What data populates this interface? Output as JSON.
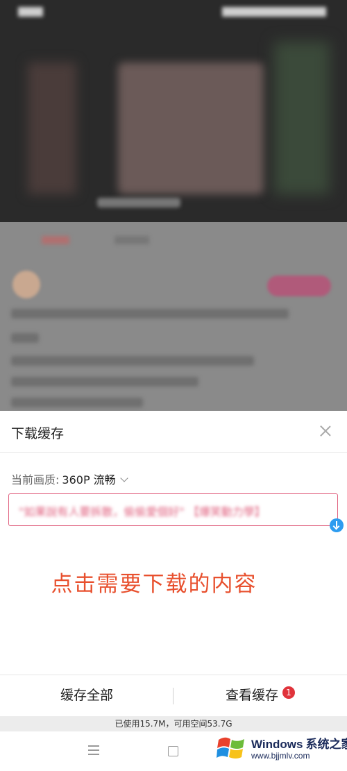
{
  "sheet": {
    "title": "下载缓存",
    "quality_label": "当前画质:",
    "quality_value": "360P 流畅",
    "episode_title": "\"如果說有人要拆散，偷偷愛個好\" 【爆笑動力學】"
  },
  "instruction": "点击需要下载的内容",
  "actions": {
    "cache_all": "缓存全部",
    "view_cache": "查看缓存",
    "view_cache_badge": "1"
  },
  "storage": {
    "text": "已使用15.7M，可用空间53.7G"
  },
  "watermark": {
    "brand": "Windows",
    "brand_cn": "系统之家",
    "url": "www.bjjmlv.com"
  },
  "colors": {
    "accent_pink": "#e0607e",
    "instruction_red": "#e8502e",
    "badge_red": "#e0333b",
    "download_blue": "#2d9cf0"
  }
}
